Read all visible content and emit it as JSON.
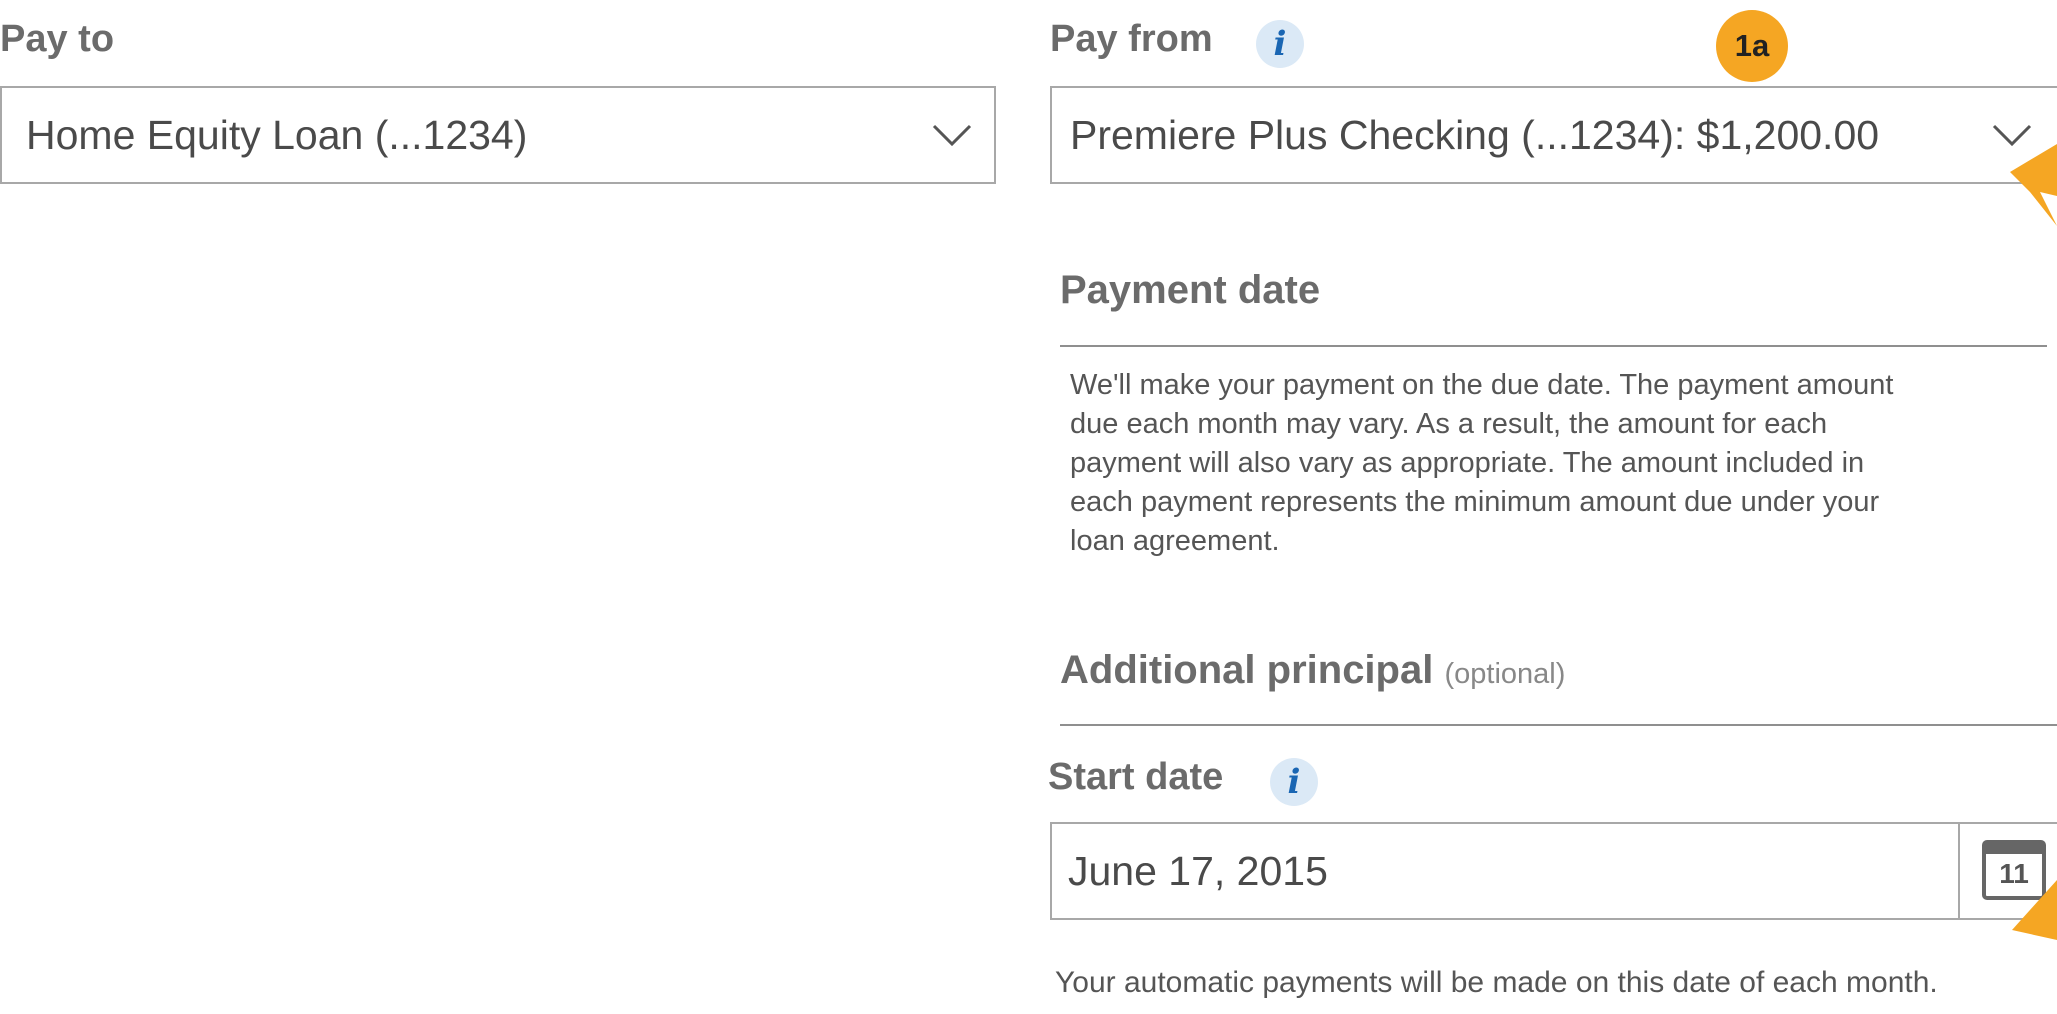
{
  "pay_to": {
    "label": "Pay to",
    "selected": "Home Equity Loan (...1234)",
    "icon": "chevron-down-icon"
  },
  "pay_from": {
    "label": "Pay from",
    "selected": "Premiere Plus Checking (...1234): $1,200.00",
    "icon": "chevron-down-icon",
    "info_icon": "i"
  },
  "annotation": {
    "badge": "1a",
    "color": "#f5a623"
  },
  "payment_date": {
    "title": "Payment date",
    "description": "We'll make your payment on the due date. The payment amount due each month may vary. As a result, the amount for each payment will also vary as appropriate. The amount included in each payment represents the minimum amount due under your loan agreement."
  },
  "additional_principal": {
    "title": "Additional principal",
    "optional": "(optional)"
  },
  "start_date": {
    "label": "Start date",
    "info_icon": "i",
    "value": "June 17, 2015",
    "calendar_day": "11",
    "helper": "Your automatic payments will be made on this date of each month."
  },
  "colors": {
    "accent_info": "#1a66b3",
    "info_bg": "#dbe9f6",
    "border": "#a8a8a8",
    "label": "#6b6b6b"
  }
}
